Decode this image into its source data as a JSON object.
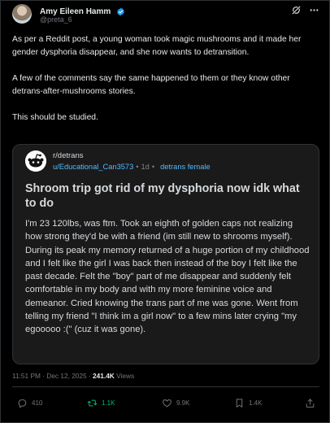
{
  "author": {
    "display_name": "Amy Eileen Hamm",
    "handle": "@preta_6"
  },
  "tweet": {
    "paragraphs": [
      "As per a Reddit post, a young woman took magic mushrooms and it made her gender dysphoria disappear, and she now wants to detransition.",
      "A few of the comments say the same happened to them or they know other detrans-after-mushrooms stories.",
      "This should be studied."
    ]
  },
  "quote": {
    "subreddit": "r/detrans",
    "user": "u/Educational_Can3573",
    "separator": "•",
    "age": "1d",
    "flair": "detrans female",
    "title": "Shroom trip got rid of my dysphoria now idk what to do",
    "body": "I'm 23 120lbs, was ftm. Took an eighth of golden caps not realizing how strong they'd be with a friend (im still new to shrooms myself). During its peak my memory returned of a huge portion of my childhood and I felt like the girl I was back then instead of the boy I felt like the past decade. Felt the \"boy\" part of me disappear and suddenly felt comfortable in my body and with my more feminine voice and demeanor. Cried knowing the trans part of me was gone. Went from telling my friend \"I think im a girl now\" to a few mins later crying \"my egooooo :(\" (cuz it was gone)."
  },
  "timestamp": {
    "time": "11:51 PM",
    "separator": "·",
    "date": "Dec 12, 2025",
    "views_count": "241.4K",
    "views_label": "Views"
  },
  "actions": {
    "replies": "410",
    "reposts": "1.1K",
    "likes": "9.9K",
    "bookmarks": "1.4K"
  },
  "icons": [
    "verified-icon",
    "grok-icon",
    "more-icon",
    "reddit-icon",
    "reply-icon",
    "repost-icon",
    "like-icon",
    "bookmark-icon",
    "share-icon"
  ],
  "colors": {
    "background": "#000000",
    "text": "#e7e9ea",
    "muted": "#71767b",
    "verified": "#1d9bf0",
    "repost_active": "#00ba7c",
    "reddit_link": "#4fbcff",
    "quote_bg": "#1a1a1b"
  }
}
